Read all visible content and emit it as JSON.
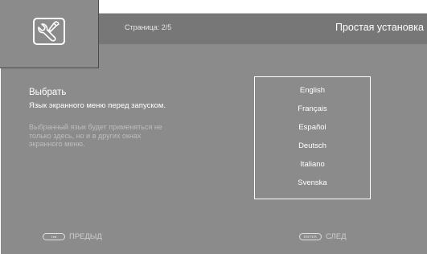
{
  "header": {
    "page_indicator": "Страница: 2/5",
    "title": "Простая установка"
  },
  "icon": {
    "name": "wrench-icon"
  },
  "section": {
    "title": "Выбрать",
    "subtitle": "Язык экранного меню перед запуском.",
    "description_lines": [
      "Выбранный язык будет применяться не",
      "только здесь, но и в других окнах",
      "экранного меню."
    ]
  },
  "languages": [
    "English",
    "Français",
    "Español",
    "Deutsch",
    "Italiano",
    "Svenska"
  ],
  "footer": {
    "prev": {
      "key": "I◂◂",
      "label": "ПРЕДЫД"
    },
    "next": {
      "key": "ENTER",
      "label": "СЛЕД"
    }
  },
  "colors": {
    "background": "#8b8b8b",
    "header_bar": "#777777",
    "text": "#ffffff",
    "muted_text": "#bdbdbd"
  }
}
